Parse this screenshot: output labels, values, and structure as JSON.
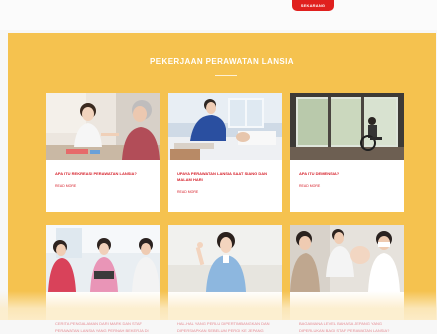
{
  "header": {
    "cta_label": "SEKARANG"
  },
  "section": {
    "title": "PEKERJAAN PERAWATAN LANSIA",
    "background": "#f5c24f",
    "accent": "#d6202a"
  },
  "cards_row1": [
    {
      "title": "APA ITU REKREASI PERAWATAN LANSIA?",
      "link": "READ MORE"
    },
    {
      "title": "UPAYA PERAWATAN LANSIA SAAT SIANG DAN MALAM HARI",
      "link": "READ MORE"
    },
    {
      "title": "APA ITU DEMENSIA?",
      "link": "READ MORE"
    }
  ],
  "cards_row2": [
    {
      "title": "CERITA PENGALAMAN DARI MARK DAN STAF PERAWATAN LANSIA YANG PERNAH BEKERJA DI"
    },
    {
      "title": "HAL-HAL YANG PERLU DIPERTIMBANGKAN DAN DIPERSIAPKAN SEBELUM PERGI KE JEPANG"
    },
    {
      "title": "BAGAIMANA LEVEL BAHASA JEPANG YANG DIPERLUKAN BAGI STAF PERAWATAN LANSIA?"
    }
  ]
}
